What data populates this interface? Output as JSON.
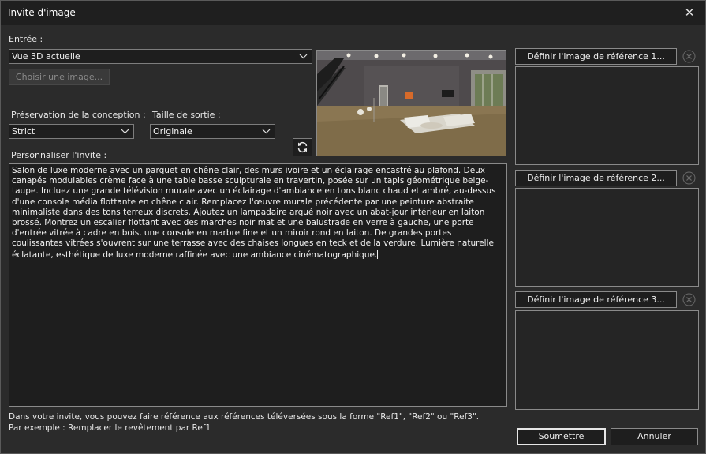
{
  "window": {
    "title": "Invite d'image",
    "close_glyph": "✕"
  },
  "input": {
    "label": "Entrée :",
    "source_value": "Vue 3D actuelle",
    "choose_image_label": "Choisir une image..."
  },
  "design_preservation": {
    "label": "Préservation de la conception :",
    "value": "Strict"
  },
  "output_size": {
    "label": "Taille de sortie :",
    "value": "Originale"
  },
  "prompt": {
    "label": "Personnaliser l'invite :",
    "text": "Salon de luxe moderne avec un parquet en chêne clair, des murs ivoire et un éclairage encastré au plafond. Deux canapés modulables crème face à une table basse sculpturale en travertin, posée sur un tapis géométrique beige-taupe. Incluez une grande télévision murale avec un éclairage d'ambiance en tons blanc chaud et ambré, au-dessus d'une console média flottante en chêne clair. Remplacez l'œuvre murale précédente par une peinture abstraite minimaliste dans des tons terreux discrets. Ajoutez un lampadaire arqué noir avec un abat-jour intérieur en laiton brossé. Montrez un escalier flottant avec des marches noir mat et une balustrade en verre à gauche, une porte d'entrée vitrée à cadre en bois, une console en marbre fine et un miroir rond en laiton. De grandes portes coulissantes vitrées s'ouvrent sur une terrasse avec des chaises longues en teck et de la verdure. Lumière naturelle éclatante, esthétique de luxe moderne raffinée avec une ambiance cinématographique."
  },
  "references": [
    {
      "button_label": "Définir l'image de référence 1..."
    },
    {
      "button_label": "Définir l'image de référence 2..."
    },
    {
      "button_label": "Définir l'image de référence 3..."
    }
  ],
  "hint": {
    "line1": "Dans votre invite, vous pouvez faire référence aux références téléversées sous la forme \"Ref1\", \"Ref2\" ou \"Ref3\".",
    "line2": "Par exemple : Remplacer le revêtement par Ref1"
  },
  "actions": {
    "submit_label": "Soumettre",
    "cancel_label": "Annuler"
  },
  "colors": {
    "background": "#2b2b2b",
    "field": "#1e1e1e",
    "border": "#8a8a8a",
    "titlebar": "#1f1f1f"
  },
  "icons": [
    "close-icon",
    "chevron-down-icon",
    "refresh-icon",
    "clear-icon"
  ]
}
